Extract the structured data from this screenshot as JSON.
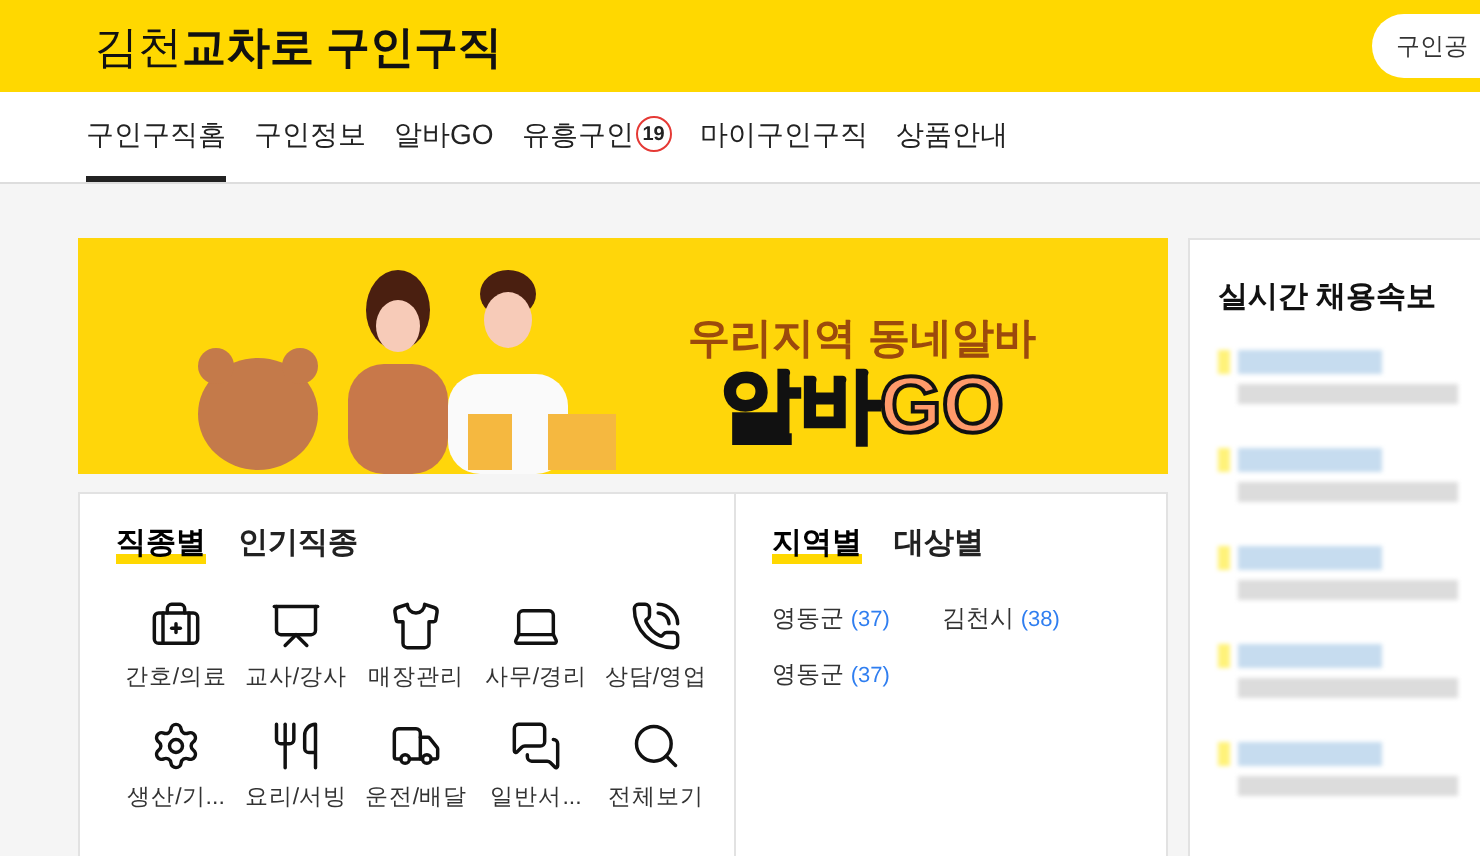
{
  "header": {
    "logo": {
      "region": "김천",
      "brand": "교차로",
      "service": "구인구직"
    },
    "button": "구인공"
  },
  "nav": [
    {
      "label": "구인구직홈",
      "selected": true
    },
    {
      "label": "구인정보",
      "selected": false
    },
    {
      "label": "알바GO",
      "selected": false
    },
    {
      "label": "유흥구인",
      "selected": false,
      "badge": "19"
    },
    {
      "label": "마이구인구직",
      "selected": false
    },
    {
      "label": "상품안내",
      "selected": false
    }
  ],
  "banner": {
    "tagline": "우리지역 동네알바",
    "brand_main": "알바",
    "brand_accent": "GO"
  },
  "categories": {
    "tabs": [
      {
        "label": "직종별",
        "selected": true
      },
      {
        "label": "인기직종",
        "selected": false
      }
    ],
    "items": [
      "간호/의료",
      "교사/강사",
      "매장관리",
      "사무/경리",
      "상담/영업",
      "생산/기...",
      "요리/서빙",
      "운전/배달",
      "일반서...",
      "전체보기"
    ]
  },
  "regions": {
    "tabs": [
      {
        "label": "지역별",
        "selected": true
      },
      {
        "label": "대상별",
        "selected": false
      }
    ],
    "items": [
      {
        "name": "영동군",
        "count": "(37)"
      },
      {
        "name": "김천시",
        "count": "(38)"
      },
      {
        "name": "영동군",
        "count": "(37)"
      }
    ]
  },
  "realtime": {
    "title": "실시간 채용속보"
  }
}
